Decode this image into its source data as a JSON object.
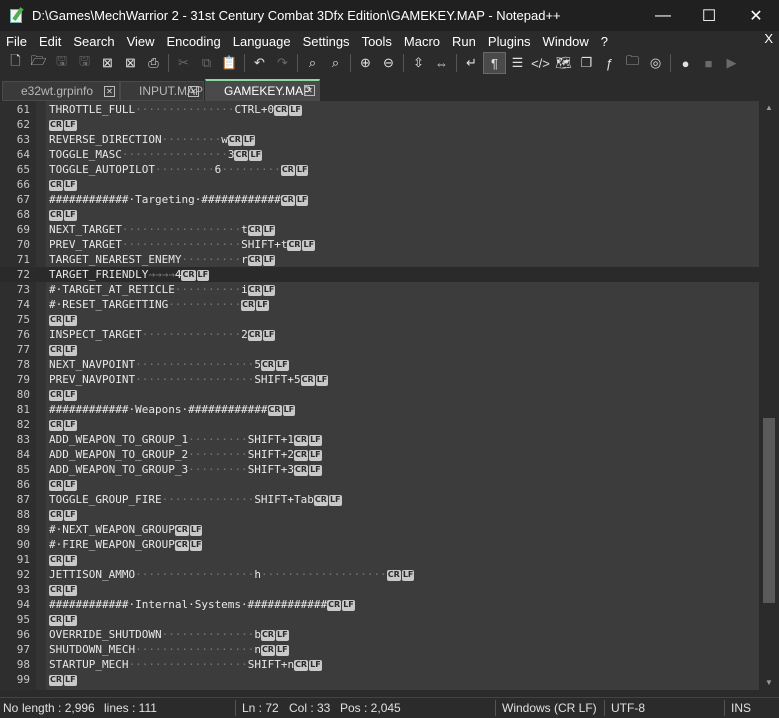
{
  "window": {
    "title": "D:\\Games\\MechWarrior 2 - 31st Century Combat 3Dfx Edition\\GAMEKEY.MAP - Notepad++",
    "minimize_glyph": "—",
    "maximize_glyph": "☐",
    "close_glyph": "✕"
  },
  "menu": {
    "items": [
      "File",
      "Edit",
      "Search",
      "View",
      "Encoding",
      "Language",
      "Settings",
      "Tools",
      "Macro",
      "Run",
      "Plugins",
      "Window",
      "?"
    ],
    "close_label": "X"
  },
  "toolbar": {
    "icons": [
      "new-file-icon",
      "open-file-icon",
      "save-icon",
      "save-all-icon",
      "close-icon",
      "close-all-icon",
      "print-icon",
      "cut-icon",
      "copy-icon",
      "paste-icon",
      "undo-icon",
      "redo-icon",
      "find-icon",
      "replace-icon",
      "zoom-in-icon",
      "zoom-out-icon",
      "sync-vertical-icon",
      "sync-horizontal-icon",
      "word-wrap-icon",
      "show-all-chars-icon",
      "indent-guide-icon",
      "xml-tag-icon",
      "document-map-icon",
      "document-list-icon",
      "function-list-icon",
      "folder-workspace-icon",
      "monitoring-icon",
      "record-macro-icon",
      "stop-record-icon",
      "play-macro-icon"
    ]
  },
  "tabs": [
    {
      "label": "e32wt.grpinfo",
      "active": false
    },
    {
      "label": "INPUT.MAP",
      "active": false
    },
    {
      "label": "GAMEKEY.MAP",
      "active": true
    }
  ],
  "editor": {
    "current_line": 72,
    "eol_cr": "CR",
    "eol_lf": "LF",
    "lines": [
      {
        "n": "61",
        "key": "THROTTLE_FULL",
        "dots": "···············",
        "val": "CTRL+0",
        "eol": true
      },
      {
        "n": "62",
        "key": "",
        "dots": "",
        "val": "",
        "eol": true
      },
      {
        "n": "63",
        "key": "REVERSE_DIRECTION",
        "dots": "·········",
        "val": "w",
        "eol": true
      },
      {
        "n": "64",
        "key": "TOGGLE_MASC",
        "dots": "················",
        "val": "3",
        "eol": true
      },
      {
        "n": "65",
        "key": "TOGGLE_AUTOPILOT",
        "dots": "·········",
        "val": "6",
        "tail": "·········",
        "eol": true
      },
      {
        "n": "66",
        "key": "",
        "dots": "",
        "val": "",
        "eol": true
      },
      {
        "n": "67",
        "key": "############·Targeting·############",
        "dots": "",
        "val": "",
        "eol": true
      },
      {
        "n": "68",
        "key": "",
        "dots": "",
        "val": "",
        "eol": true
      },
      {
        "n": "69",
        "key": "NEXT_TARGET",
        "dots": "··················",
        "val": "t",
        "eol": true
      },
      {
        "n": "70",
        "key": "PREV_TARGET",
        "dots": "··················",
        "val": "SHIFT+t",
        "eol": true
      },
      {
        "n": "71",
        "key": "TARGET_NEAREST_ENEMY",
        "dots": "·········",
        "val": "r",
        "eol": true
      },
      {
        "n": "72",
        "key": "TARGET_FRIENDLY",
        "arrows": "→→→→",
        "val": "4",
        "eol": true
      },
      {
        "n": "73",
        "key": "#·TARGET_AT_RETICLE",
        "dots": "··········",
        "val": "i",
        "eol": true
      },
      {
        "n": "74",
        "key": "#·RESET_TARGETTING",
        "dots": "···········",
        "val": "",
        "eol": true
      },
      {
        "n": "75",
        "key": "",
        "dots": "",
        "val": "",
        "eol": true
      },
      {
        "n": "76",
        "key": "INSPECT_TARGET",
        "dots": "···············",
        "val": "2",
        "eol": true
      },
      {
        "n": "77",
        "key": "",
        "dots": "",
        "val": "",
        "eol": true
      },
      {
        "n": "78",
        "key": "NEXT_NAVPOINT",
        "dots": "··················",
        "val": "5",
        "eol": true
      },
      {
        "n": "79",
        "key": "PREV_NAVPOINT",
        "dots": "··················",
        "val": "SHIFT+5",
        "eol": true
      },
      {
        "n": "80",
        "key": "",
        "dots": "",
        "val": "",
        "eol": true
      },
      {
        "n": "81",
        "key": "############·Weapons·############",
        "dots": "",
        "val": "",
        "eol": true
      },
      {
        "n": "82",
        "key": "",
        "dots": "",
        "val": "",
        "eol": true
      },
      {
        "n": "83",
        "key": "ADD_WEAPON_TO_GROUP_1",
        "dots": "·········",
        "val": "SHIFT+1",
        "eol": true
      },
      {
        "n": "84",
        "key": "ADD_WEAPON_TO_GROUP_2",
        "dots": "·········",
        "val": "SHIFT+2",
        "eol": true
      },
      {
        "n": "85",
        "key": "ADD_WEAPON_TO_GROUP_3",
        "dots": "·········",
        "val": "SHIFT+3",
        "eol": true
      },
      {
        "n": "86",
        "key": "",
        "dots": "",
        "val": "",
        "eol": true
      },
      {
        "n": "87",
        "key": "TOGGLE_GROUP_FIRE",
        "dots": "··············",
        "val": "SHIFT+Tab",
        "eol": true
      },
      {
        "n": "88",
        "key": "",
        "dots": "",
        "val": "",
        "eol": true
      },
      {
        "n": "89",
        "key": "#·NEXT_WEAPON_GROUP",
        "dots": "",
        "val": "",
        "eol": true
      },
      {
        "n": "90",
        "key": "#·FIRE_WEAPON_GROUP",
        "dots": "",
        "val": "",
        "eol": true
      },
      {
        "n": "91",
        "key": "",
        "dots": "",
        "val": "",
        "eol": true
      },
      {
        "n": "92",
        "key": "JETTISON_AMMO",
        "dots": "··················",
        "val": "h",
        "tail": "···················",
        "eol": true
      },
      {
        "n": "93",
        "key": "",
        "dots": "",
        "val": "",
        "eol": true
      },
      {
        "n": "94",
        "key": "############·Internal·Systems·############",
        "dots": "",
        "val": "",
        "eol": true
      },
      {
        "n": "95",
        "key": "",
        "dots": "",
        "val": "",
        "eol": true
      },
      {
        "n": "96",
        "key": "OVERRIDE_SHUTDOWN",
        "dots": "··············",
        "val": "b",
        "eol": true
      },
      {
        "n": "97",
        "key": "SHUTDOWN_MECH",
        "dots": "··················",
        "val": "n",
        "eol": true
      },
      {
        "n": "98",
        "key": "STARTUP_MECH",
        "dots": "··················",
        "val": "SHIFT+n",
        "eol": true
      },
      {
        "n": "99",
        "key": "",
        "dots": "",
        "val": "",
        "eol": true
      }
    ],
    "scroll_thumb_fraction_start": 0.54,
    "scroll_thumb_fraction_size": 0.33
  },
  "status": {
    "type": "No",
    "length": "length : 2,996",
    "lines": "lines : 111",
    "ln": "Ln : 72",
    "col": "Col : 33",
    "pos": "Pos : 2,045",
    "eol_mode": "Windows (CR LF)",
    "encoding": "UTF-8",
    "ins": "INS"
  }
}
